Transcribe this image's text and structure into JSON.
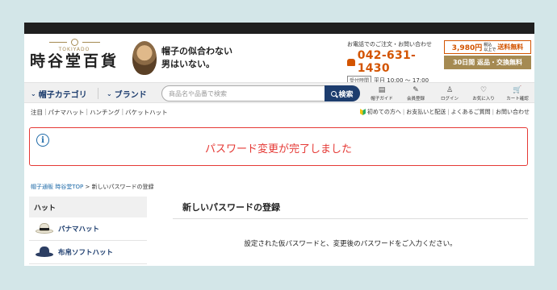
{
  "header": {
    "logo_roman": "TOKIYADO",
    "logo_name": "時谷堂百貨",
    "tagline_line1": "帽子の似合わない",
    "tagline_line2": "男はいない。",
    "contact_lead": "お電話でのご注文・お問い合わせ",
    "phone": "042-631-1430",
    "hours_badge": "受付時間",
    "hours": "平日 10:00 ～ 17:00",
    "promo_price": "3,980円",
    "promo_small1": "税込",
    "promo_small2": "以上で",
    "promo_free": "送料無料",
    "promo_return": "30日間 返品・交換無料"
  },
  "nav": {
    "category": "帽子カテゴリ",
    "brand": "ブランド",
    "search_placeholder": "商品名や品番で検索",
    "search_button": "検索",
    "icons": [
      {
        "label": "帽子ガイド",
        "icon": "guide-icon",
        "glyph": "▤"
      },
      {
        "label": "会員登録",
        "icon": "register-icon",
        "glyph": "✎"
      },
      {
        "label": "ログイン",
        "icon": "login-icon",
        "glyph": "♙"
      },
      {
        "label": "お気に入り",
        "icon": "heart-icon",
        "glyph": "♡"
      },
      {
        "label": "カート確認",
        "icon": "cart-icon",
        "glyph": "🛒"
      }
    ]
  },
  "sublinks": [
    "注目",
    "パナマハット",
    "ハンチング",
    "バケットハット"
  ],
  "help_links": [
    "初めての方へ",
    "お支払いと配送",
    "よくあるご質問",
    "お問い合わせ"
  ],
  "alert": {
    "icon": "i",
    "message": "パスワード変更が完了しました"
  },
  "breadcrumb": {
    "site": "帽子通販 時谷堂TOP",
    "separator": " > ",
    "current": "新しいパスワードの登録"
  },
  "sidebar": {
    "heading": "ハット",
    "items": [
      {
        "label": "パナマハット",
        "icon": "panama-hat-icon"
      },
      {
        "label": "布帛ソフトハット",
        "icon": "soft-hat-icon"
      }
    ]
  },
  "main": {
    "title": "新しいパスワードの登録",
    "description": "設定された仮パスワードと、変更後のパスワードをご入力ください。"
  },
  "colors": {
    "navy": "#1d3d6e",
    "alert_red": "#e53935",
    "accent_orange": "#d35400",
    "gold": "#a58a52",
    "background": "#d3e6e8"
  }
}
